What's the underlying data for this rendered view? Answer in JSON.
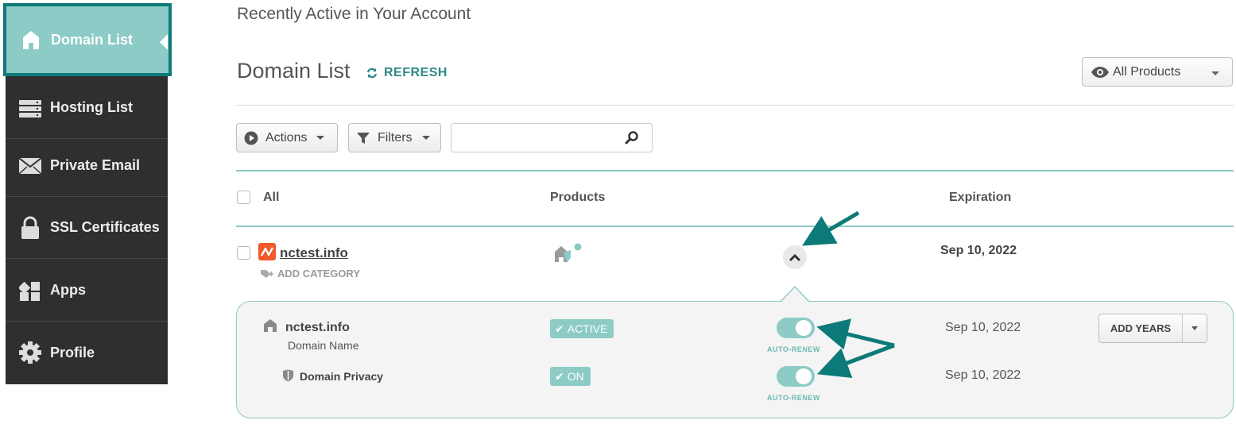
{
  "sidebar": {
    "items": [
      {
        "label": "Domain List",
        "icon": "house-icon",
        "active": true
      },
      {
        "label": "Hosting List",
        "icon": "server-icon"
      },
      {
        "label": "Private Email",
        "icon": "envelope-icon"
      },
      {
        "label": "SSL Certificates",
        "icon": "lock-icon"
      },
      {
        "label": "Apps",
        "icon": "apps-grid-icon"
      },
      {
        "label": "Profile",
        "icon": "gear-icon"
      }
    ]
  },
  "header": {
    "recent": "Recently Active in Your Account",
    "title": "Domain List",
    "refresh": "REFRESH",
    "filter_select": "All Products"
  },
  "toolbar": {
    "actions": "Actions",
    "filters": "Filters",
    "search_placeholder": ""
  },
  "table": {
    "headers": {
      "all": "All",
      "products": "Products",
      "expiration": "Expiration"
    },
    "row": {
      "domain": "nctest.info",
      "add_category": "ADD CATEGORY",
      "expiration": "Sep 10, 2022"
    }
  },
  "details": {
    "domain": {
      "name": "nctest.info",
      "subtitle": "Domain Name",
      "status": "ACTIVE",
      "auto_renew": "AUTO-RENEW",
      "date": "Sep 10, 2022",
      "add_years": "ADD YEARS"
    },
    "privacy": {
      "name": "Domain Privacy",
      "status": "ON",
      "auto_renew": "AUTO-RENEW",
      "date": "Sep 10, 2022"
    }
  },
  "colors": {
    "accent": "#8ccbc6",
    "accent_dark": "#0c7a79",
    "sidebar_bg": "#2f2f2f",
    "brand_orange": "#f1592a"
  }
}
